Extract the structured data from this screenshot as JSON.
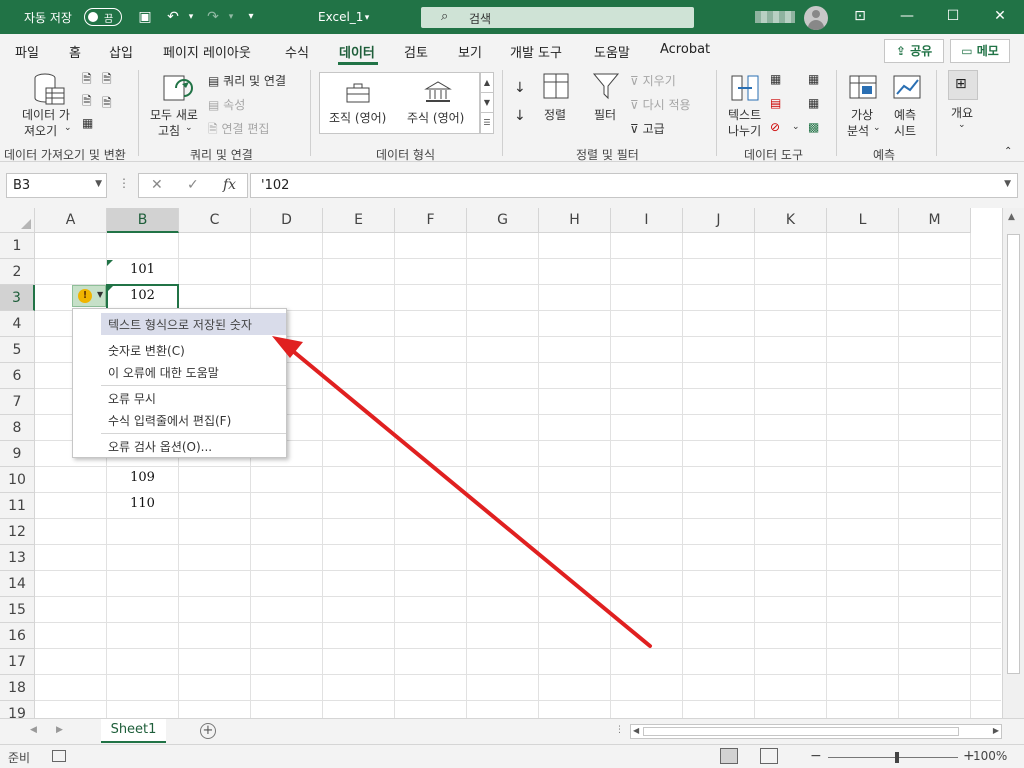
{
  "titlebar": {
    "autosave_label": "자동 저장",
    "autosave_state": "끔",
    "filename": "Excel_1",
    "search_placeholder": "검색"
  },
  "tabs": {
    "items": [
      "파일",
      "홈",
      "삽입",
      "페이지 레이아웃",
      "수식",
      "데이터",
      "검토",
      "보기",
      "개발 도구",
      "도움말",
      "Acrobat"
    ],
    "active": "데이터",
    "share": "공유",
    "memo": "메모"
  },
  "ribbon": {
    "get_data": [
      "데이터 가",
      "져오기"
    ],
    "group_get": "데이터 가져오기 및 변환",
    "refresh_all": [
      "모두 새로",
      "고침"
    ],
    "queries_connections": "쿼리 및 연결",
    "properties": "속성",
    "edit_links": "연결 편집",
    "group_queries": "쿼리 및 연결",
    "org": "조직 (영어)",
    "stocks": "주식 (영어)",
    "group_types": "데이터 형식",
    "sort": "정렬",
    "filter": "필터",
    "clear": "지우기",
    "reapply": "다시 적용",
    "advanced": "고급",
    "group_sort": "정렬 및 필터",
    "text_to_columns": [
      "텍스트",
      "나누기"
    ],
    "group_tools": "데이터 도구",
    "what_if": [
      "가상",
      "분석"
    ],
    "forecast_sheet": [
      "예측",
      "시트"
    ],
    "group_forecast": "예측",
    "outline": "개요"
  },
  "formula_bar": {
    "name_box": "B3",
    "content": "'102"
  },
  "grid": {
    "columns": [
      "A",
      "B",
      "C",
      "D",
      "E",
      "F",
      "G",
      "H",
      "I",
      "J",
      "K",
      "L",
      "M"
    ],
    "rows": [
      "1",
      "2",
      "3",
      "4",
      "5",
      "6",
      "7",
      "8",
      "9",
      "10",
      "11",
      "12",
      "13",
      "14",
      "15",
      "16",
      "17",
      "18",
      "19"
    ],
    "cells": {
      "B2": "101",
      "B3": "102",
      "B10": "109",
      "B11": "110"
    }
  },
  "context_menu": {
    "header": "텍스트 형식으로 저장된 숫자",
    "items": [
      "숫자로 변환(C)",
      "이 오류에 대한 도움말",
      "오류 무시",
      "수식 입력줄에서 편집(F)",
      "오류 검사 옵션(O)..."
    ]
  },
  "sheets": {
    "active": "Sheet1"
  },
  "status": {
    "ready": "준비",
    "zoom": "100%"
  },
  "colors": {
    "accent": "#217346",
    "arrow": "#e02020"
  }
}
